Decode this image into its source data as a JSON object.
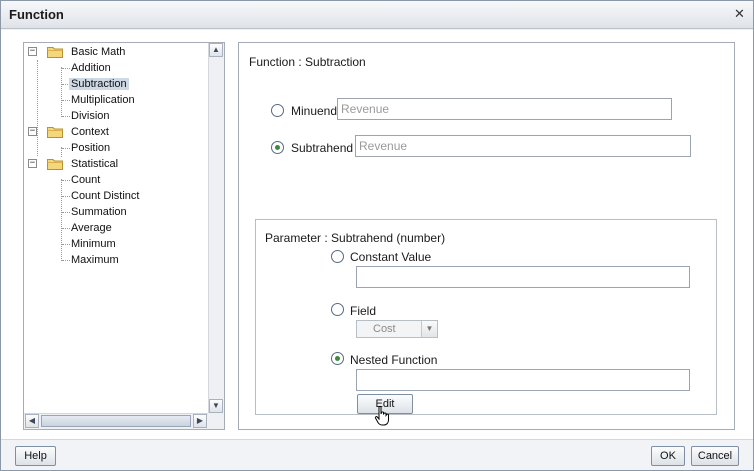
{
  "window": {
    "title": "Function",
    "close_icon": "close-icon"
  },
  "tree": {
    "groups": [
      {
        "label": "Basic Math",
        "children": [
          "Addition",
          "Subtraction",
          "Multiplication",
          "Division"
        ]
      },
      {
        "label": "Context",
        "children": [
          "Position"
        ]
      },
      {
        "label": "Statistical",
        "children": [
          "Count",
          "Count Distinct",
          "Summation",
          "Average",
          "Minimum",
          "Maximum"
        ]
      }
    ],
    "selected": "Subtraction"
  },
  "function": {
    "title": "Function : Subtraction",
    "minuend": {
      "label": "Minuend",
      "value": "Revenue",
      "checked": false
    },
    "subtrahend": {
      "label": "Subtrahend",
      "value": "Revenue",
      "checked": true
    }
  },
  "parameter": {
    "title": "Parameter : Subtrahend (number)",
    "constant": {
      "label": "Constant Value",
      "value": "",
      "checked": false
    },
    "field": {
      "label": "Field",
      "select_value": "Cost",
      "checked": false
    },
    "nested": {
      "label": "Nested Function",
      "value": "",
      "checked": true
    },
    "edit_label": "Edit"
  },
  "footer": {
    "help_label": "Help",
    "ok_label": "OK",
    "cancel_label": "Cancel"
  },
  "colors": {
    "selected_bg": "#cfd9e6",
    "radio_dot": "#3d8a3a",
    "title_bar": "#dfe3e9"
  }
}
